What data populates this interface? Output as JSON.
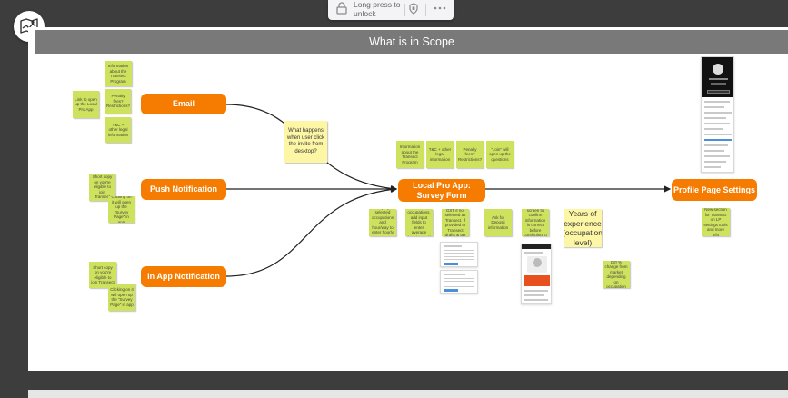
{
  "toolbar": {
    "lock_label": "Long press to unlock"
  },
  "board": {
    "title": "What is in Scope"
  },
  "nodes": {
    "email": "Email",
    "push": "Push Notification",
    "inapp": "In App Notification",
    "localpro": "Local Pro App: Survey Form",
    "profile": "Profile Page Settings"
  },
  "stickies": {
    "email_info": "Information about the Transect Program",
    "email_link": "Link to open up the Local Pro App",
    "email_penalty": "Penalty fees? Restrictions?",
    "email_tc": "T&C + other legal information",
    "desktop_question": "What happens when user click the invite from desktop?",
    "push_short": "Short copy on you're eligible to join Transect",
    "push_click": "Clicking on it will open up the \"Survey Page\" in app",
    "inapp_short": "Short copy on you're eligible to join Transect",
    "inapp_click": "Clicking on it will open up the \"Survey Page\" in app",
    "lp_info": "Information about the Transect Program",
    "lp_tc": "T&C + other legal information",
    "lp_penalty": "Penalty fees? Restrictions?",
    "lp_join": "\"Join\" will open up the questions",
    "lp_display": "Display selected occupations and hour/way to enter hourly rate",
    "lp_occupation": "Display selected occupations, add input fields to enter average hourly rate if applicable",
    "lp_gst": "Asks for GST if not selected as Transect. If provided to Transect drafts & tax threshold",
    "lp_deposit": "Ask for Deposit information",
    "lp_note": "Display screen to confirm information is correct before continuing to submit",
    "lp_years": "Years of experience (occupation level)",
    "lp_change": "Diff % change from market depending on occupation",
    "profile_note": "New section for Transect on LP settings tools and more info"
  }
}
